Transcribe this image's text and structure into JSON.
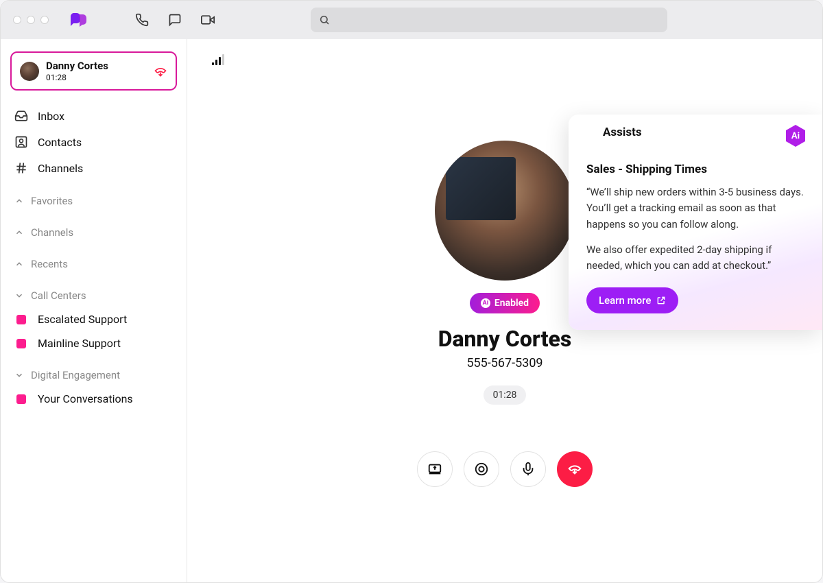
{
  "activeCall": {
    "name": "Danny Cortes",
    "time": "01:28"
  },
  "nav": {
    "inbox": "Inbox",
    "contacts": "Contacts",
    "channels": "Channels"
  },
  "sections": {
    "favorites": "Favorites",
    "channels": "Channels",
    "recents": "Recents",
    "callCenters": "Call Centers",
    "digitalEngagement": "Digital Engagement"
  },
  "callCenterItems": [
    "Escalated Support",
    "Mainline Support"
  ],
  "digitalItems": [
    "Your Conversations"
  ],
  "caller": {
    "enabledLabel": "Enabled",
    "name": "Danny Cortes",
    "phone": "555-567-5309",
    "duration": "01:28"
  },
  "assist": {
    "tab": "Assists",
    "title": "Sales - Shipping Times",
    "para1": "“We’ll ship new orders within 3-5 business days. You’ll get a tracking email as soon as that happens so you can follow along.",
    "para2": "We also offer expedited 2-day shipping if needed, which you can add at checkout.”",
    "cta": "Learn more"
  }
}
